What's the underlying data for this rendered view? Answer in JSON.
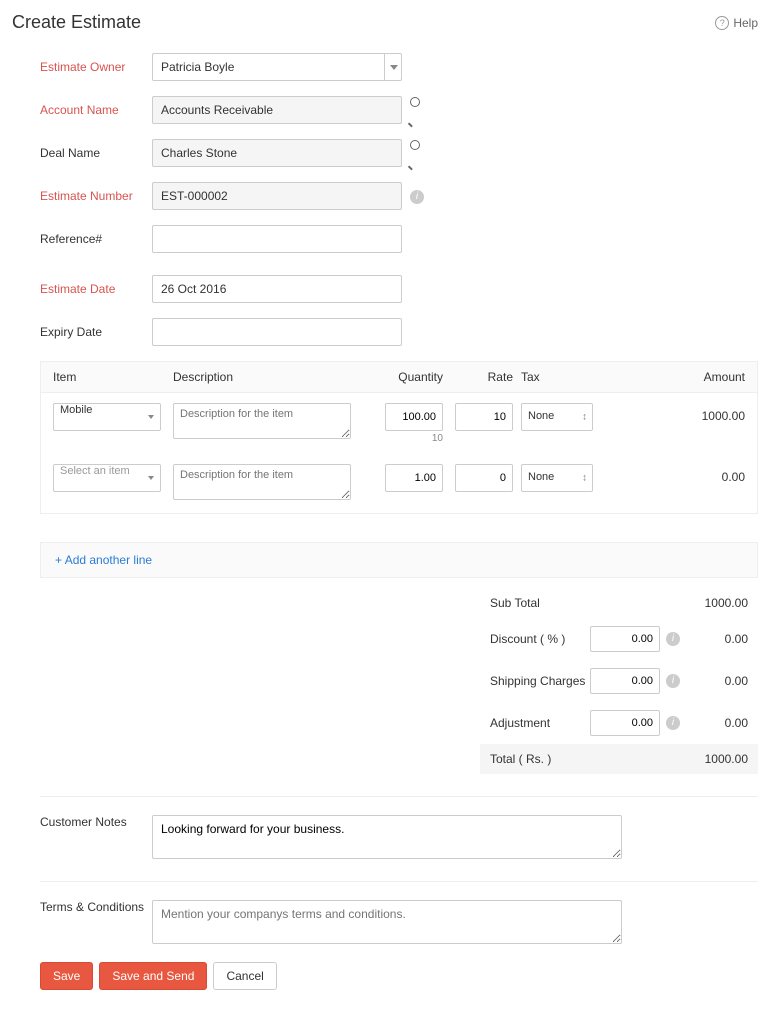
{
  "header": {
    "title": "Create Estimate",
    "help": "Help"
  },
  "form": {
    "estimate_owner": {
      "label": "Estimate Owner",
      "value": "Patricia Boyle"
    },
    "account_name": {
      "label": "Account Name",
      "value": "Accounts Receivable"
    },
    "deal_name": {
      "label": "Deal Name",
      "value": "Charles Stone"
    },
    "estimate_number": {
      "label": "Estimate Number",
      "value": "EST-000002"
    },
    "reference": {
      "label": "Reference#",
      "value": ""
    },
    "estimate_date": {
      "label": "Estimate Date",
      "value": "26 Oct 2016"
    },
    "expiry_date": {
      "label": "Expiry Date",
      "value": ""
    }
  },
  "line_items": {
    "headers": {
      "item": "Item",
      "description": "Description",
      "quantity": "Quantity",
      "rate": "Rate",
      "tax": "Tax",
      "amount": "Amount"
    },
    "rows": [
      {
        "item": "Mobile",
        "description": "",
        "desc_placeholder": "Description for the item",
        "quantity": "100.00",
        "quantity_sub": "10",
        "rate": "10",
        "tax": "None",
        "amount": "1000.00"
      },
      {
        "item": "",
        "item_placeholder": "Select an item",
        "description": "",
        "desc_placeholder": "Description for the item",
        "quantity": "1.00",
        "quantity_sub": "",
        "rate": "0",
        "tax": "None",
        "amount": "0.00"
      }
    ],
    "add_line": "Add another line"
  },
  "totals": {
    "sub_total": {
      "label": "Sub Total",
      "value": "1000.00"
    },
    "discount": {
      "label": "Discount ( % )",
      "input": "0.00",
      "value": "0.00"
    },
    "shipping": {
      "label": "Shipping Charges",
      "input": "0.00",
      "value": "0.00"
    },
    "adjustment": {
      "label": "Adjustment",
      "input": "0.00",
      "value": "0.00"
    },
    "total": {
      "label": "Total ( Rs. )",
      "value": "1000.00"
    }
  },
  "notes": {
    "label": "Customer Notes",
    "value": "Looking forward for your business."
  },
  "terms": {
    "label": "Terms & Conditions",
    "value": "",
    "placeholder": "Mention your companys terms and conditions."
  },
  "actions": {
    "save": "Save",
    "save_send": "Save and Send",
    "cancel": "Cancel"
  }
}
